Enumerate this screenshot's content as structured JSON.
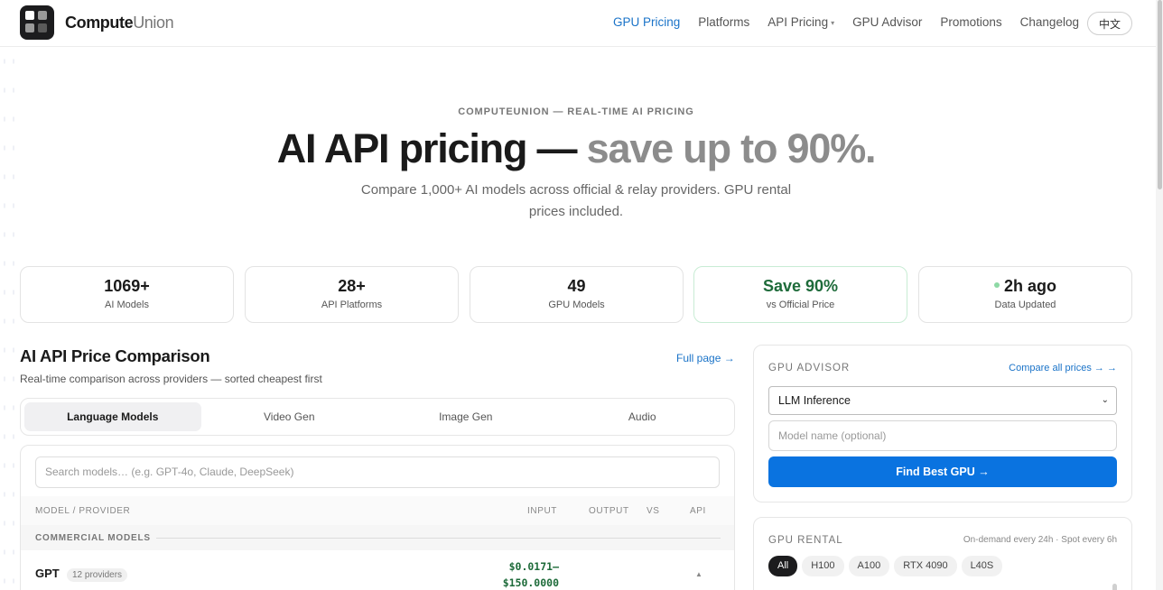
{
  "header": {
    "brand_bold": "Compute",
    "brand_light": "Union",
    "nav": [
      {
        "label": "GPU Pricing",
        "active": true
      },
      {
        "label": "Platforms"
      },
      {
        "label": "API Pricing",
        "has_dropdown": true
      },
      {
        "label": "GPU Advisor"
      },
      {
        "label": "Promotions"
      },
      {
        "label": "Changelog"
      }
    ],
    "lang_button": "中文",
    "caret": "▾"
  },
  "hero": {
    "eyebrow": "COMPUTEUNION — REAL-TIME AI PRICING",
    "title_main": "AI API pricing —",
    "title_dim": "save up to 90%.",
    "subtitle": "Compare 1,000+ AI models across official & relay providers. GPU rental prices included."
  },
  "stats": [
    {
      "value": "1069+",
      "label": "AI Models"
    },
    {
      "value": "28+",
      "label": "API Platforms"
    },
    {
      "value": "49",
      "label": "GPU Models"
    },
    {
      "value": "Save 90%",
      "label": "vs Official Price"
    },
    {
      "value": "2h ago",
      "label": "Data Updated"
    }
  ],
  "comparison": {
    "title": "AI API Price Comparison",
    "subtitle": "Real-time comparison across providers — sorted cheapest first",
    "full_page_link": "Full page →",
    "tabs": [
      "Language Models",
      "Video Gen",
      "Image Gen",
      "Audio"
    ],
    "search_placeholder": "Search models… (e.g. GPT-4o, Claude, DeepSeek)",
    "columns": {
      "model": "MODEL / PROVIDER",
      "input": "INPUT",
      "output": "OUTPUT",
      "vs": "VS",
      "api": "API"
    },
    "group_label": "COMMERCIAL MODELS",
    "rows": [
      {
        "name": "GPT",
        "providers": "12 providers",
        "price_line1": "$0.0171–",
        "price_line2": "$150.0000",
        "expand": "▲"
      }
    ]
  },
  "advisor": {
    "title": "GPU ADVISOR",
    "compare_link": "Compare all prices → →",
    "use_case": "LLM Inference",
    "select_arrow": "⌄",
    "model_placeholder": "Model name (optional)",
    "find_button": "Find Best GPU →"
  },
  "rental": {
    "title": "GPU RENTAL",
    "meta": "On-demand every 24h · Spot every 6h",
    "chips": [
      "All",
      "H100",
      "A100",
      "RTX 4090",
      "L40S"
    ]
  },
  "colors": {
    "accent": "#0a73e0",
    "link": "#1a73c8",
    "savings_green": "#1e6b3a"
  }
}
